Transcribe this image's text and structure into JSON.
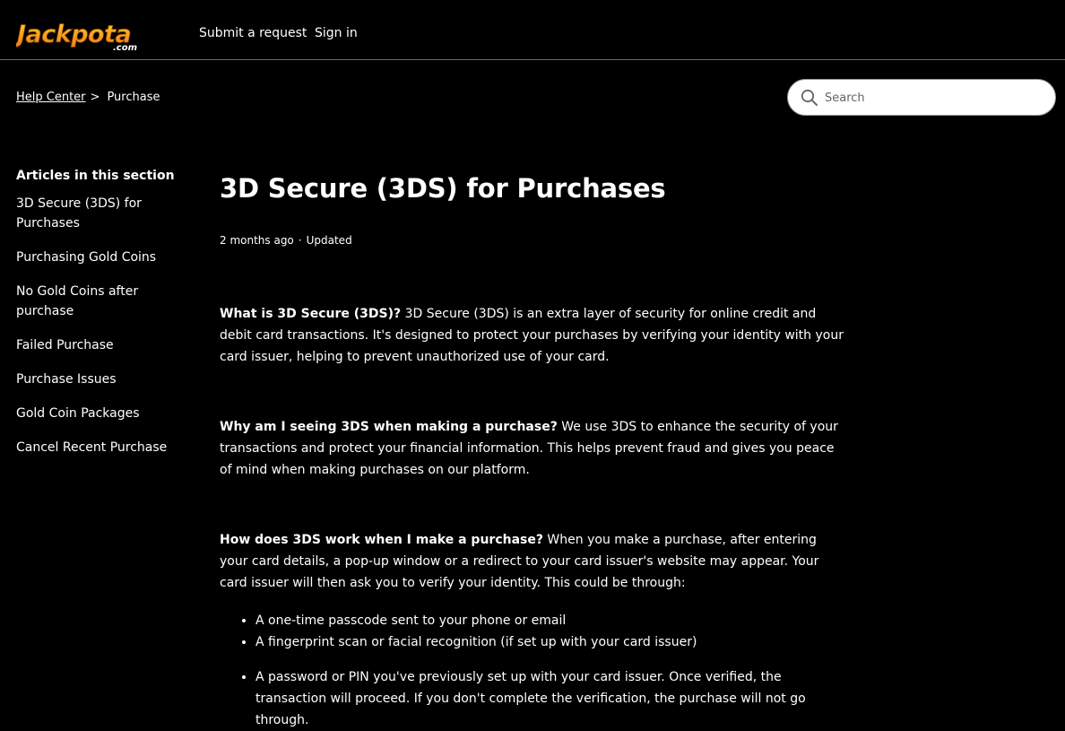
{
  "header": {
    "logo_text": "Jackpota",
    "logo_sub": ".com",
    "nav": [
      "Submit a request",
      "Sign in"
    ]
  },
  "breadcrumb": {
    "home": "Help Center",
    "separator": ">",
    "current": "Purchase"
  },
  "search": {
    "placeholder": "Search",
    "icon": "search-icon"
  },
  "sidebar": {
    "heading": "Articles in this section",
    "items": [
      "3D Secure (3DS) for Purchases",
      "Purchasing Gold Coins",
      "No Gold Coins after purchase",
      "Failed Purchase",
      "Purchase Issues",
      "Gold Coin Packages",
      "Cancel Recent Purchase"
    ]
  },
  "article": {
    "title": "3D Secure (3DS) for Purchases",
    "meta_time": "2 months ago",
    "meta_dot": "·",
    "meta_status": "Updated",
    "sections": [
      {
        "q": "What is 3D Secure (3DS)?",
        "a": " 3D Secure (3DS) is an extra layer of security for online credit and debit card transactions. It's designed to protect your purchases by verifying your identity with your card issuer, helping to prevent unauthorized use of your card."
      },
      {
        "q": "Why am I seeing 3DS when making a purchase?",
        "a": " We use 3DS to enhance the security of your transactions and protect your financial information. This helps prevent fraud and gives you peace of mind when making purchases on our platform."
      },
      {
        "q": "How does 3DS work when I make a purchase?",
        "a": " When you make a purchase, after entering your card details, a pop-up window or a redirect to your card issuer's website may appear. Your card issuer will then ask you to verify your identity. This could be through:"
      }
    ],
    "bullets": [
      "A one-time passcode sent to your phone or email",
      "A fingerprint scan or facial recognition (if set up with your card issuer)",
      "A password or PIN you've previously set up with your card issuer. Once verified, the transaction will proceed. If you don't complete the verification, the purchase will not go through."
    ]
  },
  "colors": {
    "background": "#000000",
    "text": "#ffffff",
    "logo_orange": "#f7941d",
    "search_bg": "#ffffff"
  }
}
